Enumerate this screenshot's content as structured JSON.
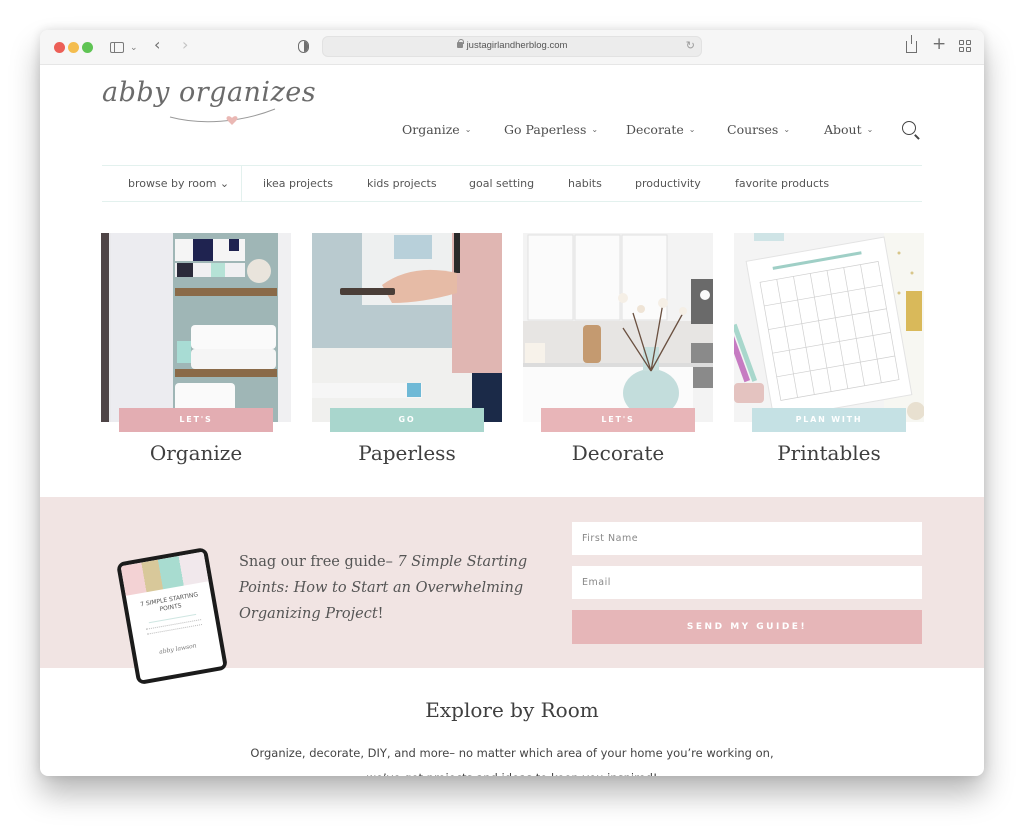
{
  "browser": {
    "url": "justagirlandherblog.com",
    "icons": [
      "close-window",
      "minimize-window",
      "zoom-window",
      "sidebar-icon",
      "chevron-down-icon",
      "back-icon",
      "forward-icon",
      "privacy-shield-icon",
      "lock-icon",
      "reload-icon",
      "share-icon",
      "new-tab-icon",
      "tab-overview-icon"
    ],
    "reload_glyph": "↻",
    "back_glyph": "‹",
    "forward_glyph": "›",
    "plus_glyph": "+",
    "chevron_glyph": "⌄"
  },
  "header": {
    "logo_text": "abby organizes",
    "nav": [
      {
        "label": "Organize"
      },
      {
        "label": "Go Paperless"
      },
      {
        "label": "Decorate"
      },
      {
        "label": "Courses"
      },
      {
        "label": "About"
      }
    ],
    "nav_chevron": "⌄",
    "search_icon": "search-icon"
  },
  "subnav": {
    "items": [
      {
        "label": "browse by room ⌄"
      },
      {
        "label": "ikea projects"
      },
      {
        "label": "kids projects"
      },
      {
        "label": "goal setting"
      },
      {
        "label": "habits"
      },
      {
        "label": "productivity"
      },
      {
        "label": "favorite products"
      }
    ]
  },
  "cards": [
    {
      "label": "LET'S",
      "title": "Organize",
      "label_color": "#e3adb2",
      "image": "linen closet with towels"
    },
    {
      "label": "GO",
      "title": "Paperless",
      "label_color": "#a9d6cd",
      "image": "hands holding phone"
    },
    {
      "label": "LET'S",
      "title": "Decorate",
      "label_color": "#e8b5b8",
      "image": "kitchen with vase of flowers"
    },
    {
      "label": "PLAN WITH",
      "title": "Printables",
      "label_color": "#c5e1e4",
      "image": "printable calendar on desk"
    }
  ],
  "optin": {
    "bg_color": "#f1e4e3",
    "text_plain": "Snag our free guide– ",
    "text_italic": "7 Simple Starting Points: How to Start an Overwhelming Organizing Project",
    "text_end": "!",
    "tablet_title": "7 SIMPLE STARTING POINTS",
    "tablet_signature": "abby lawson",
    "first_name_placeholder": "First Name",
    "email_placeholder": "Email",
    "button_label": "SEND MY GUIDE!",
    "button_color": "#e6b6b8"
  },
  "explore": {
    "title": "Explore by Room",
    "description": "Organize, decorate, DIY, and more– no matter which area of your home you’re working on, we’ve got projects and ideas to keep you inspired!"
  }
}
